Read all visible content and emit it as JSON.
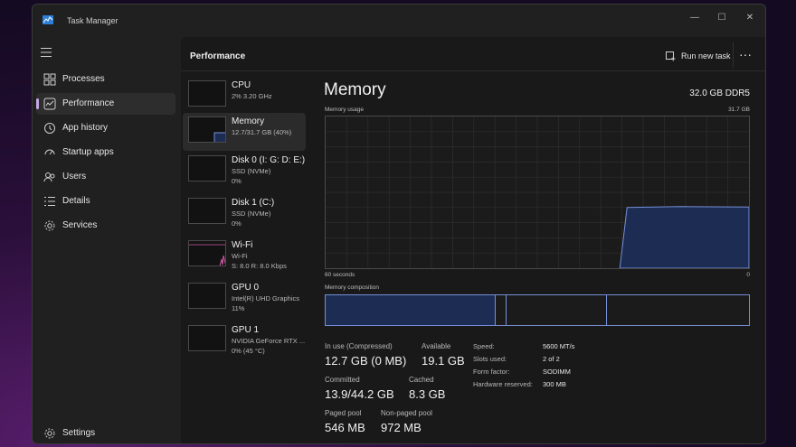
{
  "window": {
    "title": "Task Manager",
    "controls": {
      "minimize": "—",
      "maximize": "☐",
      "close": "✕"
    }
  },
  "nav": {
    "items": [
      {
        "label": "Processes",
        "icon": "processes-icon"
      },
      {
        "label": "Performance",
        "icon": "performance-icon",
        "active": true
      },
      {
        "label": "App history",
        "icon": "app-history-icon"
      },
      {
        "label": "Startup apps",
        "icon": "startup-apps-icon"
      },
      {
        "label": "Users",
        "icon": "users-icon"
      },
      {
        "label": "Details",
        "icon": "details-icon"
      },
      {
        "label": "Services",
        "icon": "services-icon"
      }
    ],
    "settings_label": "Settings"
  },
  "header": {
    "title": "Performance",
    "run_new_task": "Run new task",
    "more": "···"
  },
  "devices": [
    {
      "name": "CPU",
      "sub": "2% 3.20 GHz",
      "sub2": ""
    },
    {
      "name": "Memory",
      "sub": "12.7/31.7 GB (40%)",
      "sub2": "",
      "active": true
    },
    {
      "name": "Disk 0 (I: G: D: E:)",
      "sub": "SSD (NVMe)",
      "sub2": "0%"
    },
    {
      "name": "Disk 1 (C:)",
      "sub": "SSD (NVMe)",
      "sub2": "0%"
    },
    {
      "name": "Wi-Fi",
      "sub": "Wi-Fi",
      "sub2": "S: 8.0  R: 8.0 Kbps"
    },
    {
      "name": "GPU 0",
      "sub": "Intel(R) UHD Graphics",
      "sub2": "11%"
    },
    {
      "name": "GPU 1",
      "sub": "NVIDIA GeForce RTX ...",
      "sub2": "0% (45 °C)"
    }
  ],
  "memory": {
    "title": "Memory",
    "spec": "32.0 GB DDR5",
    "usage_label": "Memory usage",
    "usage_max": "31.7 GB",
    "time_left": "60 seconds",
    "time_right": "0",
    "composition_label": "Memory composition",
    "usage_fraction": 0.4,
    "stats": {
      "in_use_label": "In use (Compressed)",
      "in_use_value": "12.7 GB (0 MB)",
      "available_label": "Available",
      "available_value": "19.1 GB",
      "committed_label": "Committed",
      "committed_value": "13.9/44.2 GB",
      "cached_label": "Cached",
      "cached_value": "8.3 GB",
      "paged_label": "Paged pool",
      "paged_value": "546 MB",
      "nonpaged_label": "Non-paged pool",
      "nonpaged_value": "972 MB"
    },
    "details": [
      {
        "key": "Speed:",
        "value": "5600 MT/s"
      },
      {
        "key": "Slots used:",
        "value": "2 of 2"
      },
      {
        "key": "Form factor:",
        "value": "SODIMM"
      },
      {
        "key": "Hardware reserved:",
        "value": "300 MB"
      }
    ]
  },
  "colors": {
    "accent_nav": "#c7a6e8",
    "memory_line": "#7690d8",
    "memory_fill": "#1c2c52",
    "wifi": "#d05aa6"
  }
}
